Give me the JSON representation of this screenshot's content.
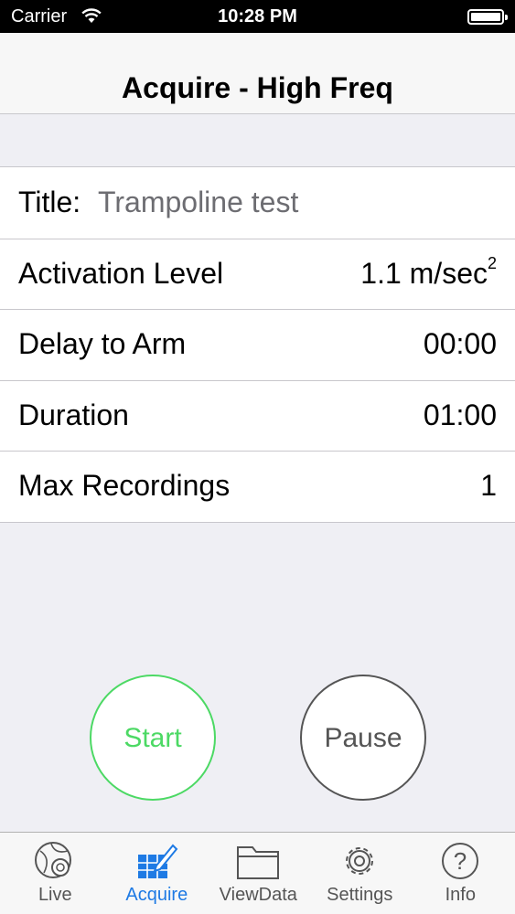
{
  "status_bar": {
    "carrier": "Carrier",
    "time": "10:28 PM"
  },
  "nav": {
    "title": "Acquire - High Freq"
  },
  "form": {
    "title_label": "Title:",
    "title_value": "Trampoline test",
    "activation_label": "Activation Level",
    "activation_value": "1.1 m/sec",
    "activation_exp": "2",
    "delay_label": "Delay to Arm",
    "delay_value": "00:00",
    "duration_label": "Duration",
    "duration_value": "01:00",
    "max_label": "Max Recordings",
    "max_value": "1"
  },
  "buttons": {
    "start": "Start",
    "pause": "Pause"
  },
  "tabs": [
    {
      "label": "Live",
      "icon": "live-icon"
    },
    {
      "label": "Acquire",
      "icon": "acquire-icon"
    },
    {
      "label": "ViewData",
      "icon": "folder-icon"
    },
    {
      "label": "Settings",
      "icon": "gear-icon"
    },
    {
      "label": "Info",
      "icon": "info-icon"
    }
  ],
  "colors": {
    "accent": "#1e7ae4",
    "start": "#4cd964",
    "pause": "#555555"
  }
}
